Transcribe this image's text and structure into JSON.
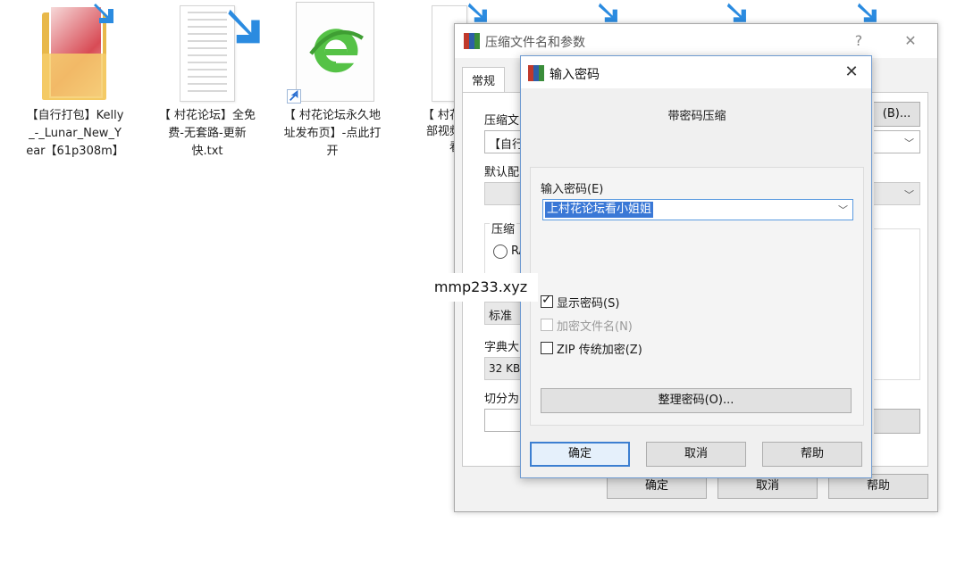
{
  "desktop": {
    "icons": [
      {
        "label": "【自行打包】Kelly_-_Lunar_New_Year【61p308m】",
        "type": "folder"
      },
      {
        "label": "【 村花论坛】全免费-无套路-更新快.txt",
        "type": "text-file"
      },
      {
        "label": "【 村花论坛永久地址发布页】-点此打开",
        "type": "ie-shortcut"
      },
      {
        "label": "【 村花",
        "type": "partial"
      }
    ],
    "partial_labels": [
      "部视频",
      "看"
    ]
  },
  "back_dialog": {
    "title": "压缩文件名和参数",
    "help_glyph": "?",
    "close_glyph": "✕",
    "tab_general": "常规",
    "label_archive_name": "压缩文",
    "browse_button": "(B)...",
    "archive_value_partial": "【自行",
    "label_default": "默认配",
    "label_format": "压缩",
    "radio_partial": "RA",
    "label_method_value": "标准",
    "label_dict": "字典大",
    "dict_value": "32 KB",
    "label_split": "切分为",
    "ok": "确定",
    "cancel": "取消",
    "help": "帮助"
  },
  "front_dialog": {
    "title": "输入密码",
    "close_glyph": "✕",
    "heading": "带密码压缩",
    "field_label": "输入密码(E)",
    "password_value": "上村花论坛看小姐姐",
    "checkbox_show": {
      "label": "显示密码(S)",
      "checked": true,
      "enabled": true
    },
    "checkbox_encrypt_names": {
      "label": "加密文件名(N)",
      "checked": false,
      "enabled": false
    },
    "checkbox_zip_legacy": {
      "label": "ZIP 传统加密(Z)",
      "checked": false,
      "enabled": true
    },
    "organize_button": "整理密码(O)...",
    "ok": "确定",
    "cancel": "取消",
    "help": "帮助"
  },
  "watermark": "mmp233.xyz",
  "colors": {
    "accent": "#3a78d6",
    "border_focus": "#6f9bd1",
    "winrar_red": "#c0392b",
    "winrar_blue": "#2e5fa8",
    "winrar_green": "#3a8d3a"
  }
}
